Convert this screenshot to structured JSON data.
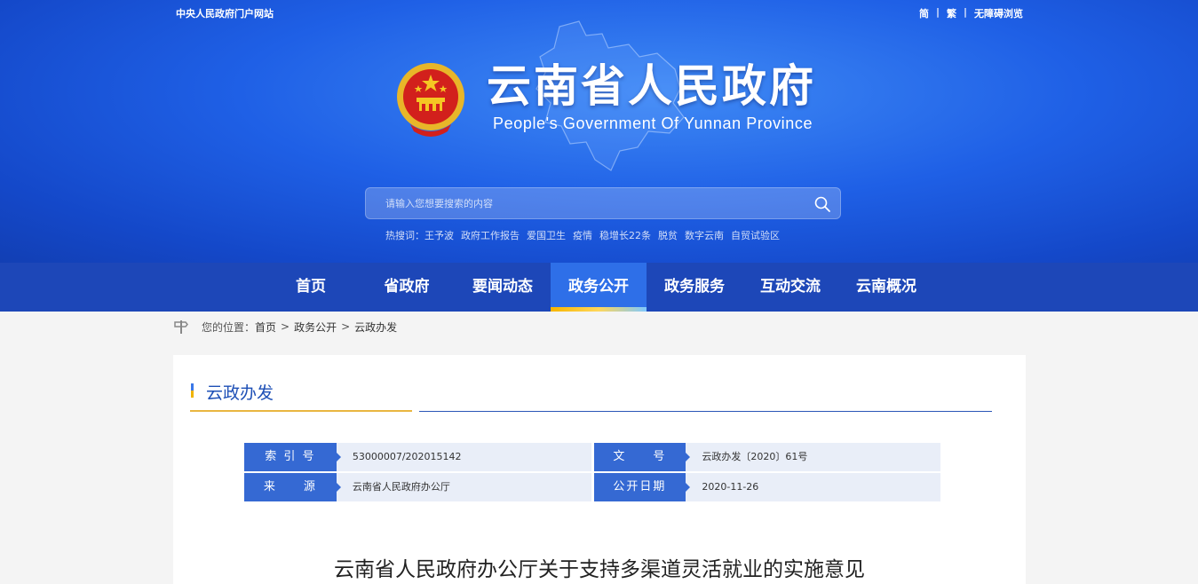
{
  "header": {
    "portal_link": "中央人民政府门户网站",
    "lang_links": [
      "简",
      "繁",
      "无障碍浏览"
    ],
    "title": "云南省人民政府",
    "subtitle": "People's Government Of Yunnan Province",
    "search": {
      "placeholder": "请输入您想要搜索的内容"
    },
    "hotwords_label": "热搜词：",
    "hotwords": [
      "王予波",
      "政府工作报告",
      "爱国卫生",
      "疫情",
      "稳增长22条",
      "脱贫",
      "数字云南",
      "自贸试验区"
    ]
  },
  "nav": {
    "items": [
      {
        "label": "首页"
      },
      {
        "label": "省政府"
      },
      {
        "label": "要闻动态"
      },
      {
        "label": "政务公开",
        "active": true
      },
      {
        "label": "政务服务"
      },
      {
        "label": "互动交流"
      },
      {
        "label": "云南概况"
      }
    ]
  },
  "breadcrumb": {
    "prefix": "您的位置：",
    "items": [
      "首页",
      "政务公开",
      "云政办发"
    ],
    "separator": ">"
  },
  "card": {
    "category": "云政办发",
    "meta": {
      "index_label": "索 引 号",
      "index_value": "53000007/202015142",
      "docno_label": "文　　号",
      "docno_value": "云政办发〔2020〕61号",
      "source_label": "来　　源",
      "source_value": "云南省人民政府办公厅",
      "date_label": "公开日期",
      "date_value": "2020-11-26"
    },
    "doc_title": "云南省人民政府办公厅关于支持多渠道灵活就业的实施意见"
  },
  "colors": {
    "header_blue": "#1f60e6",
    "nav_blue": "#1d47b8",
    "nav_active": "#2e6fe8",
    "label_blue": "#3569d3",
    "accent_gold": "#e9b640"
  }
}
